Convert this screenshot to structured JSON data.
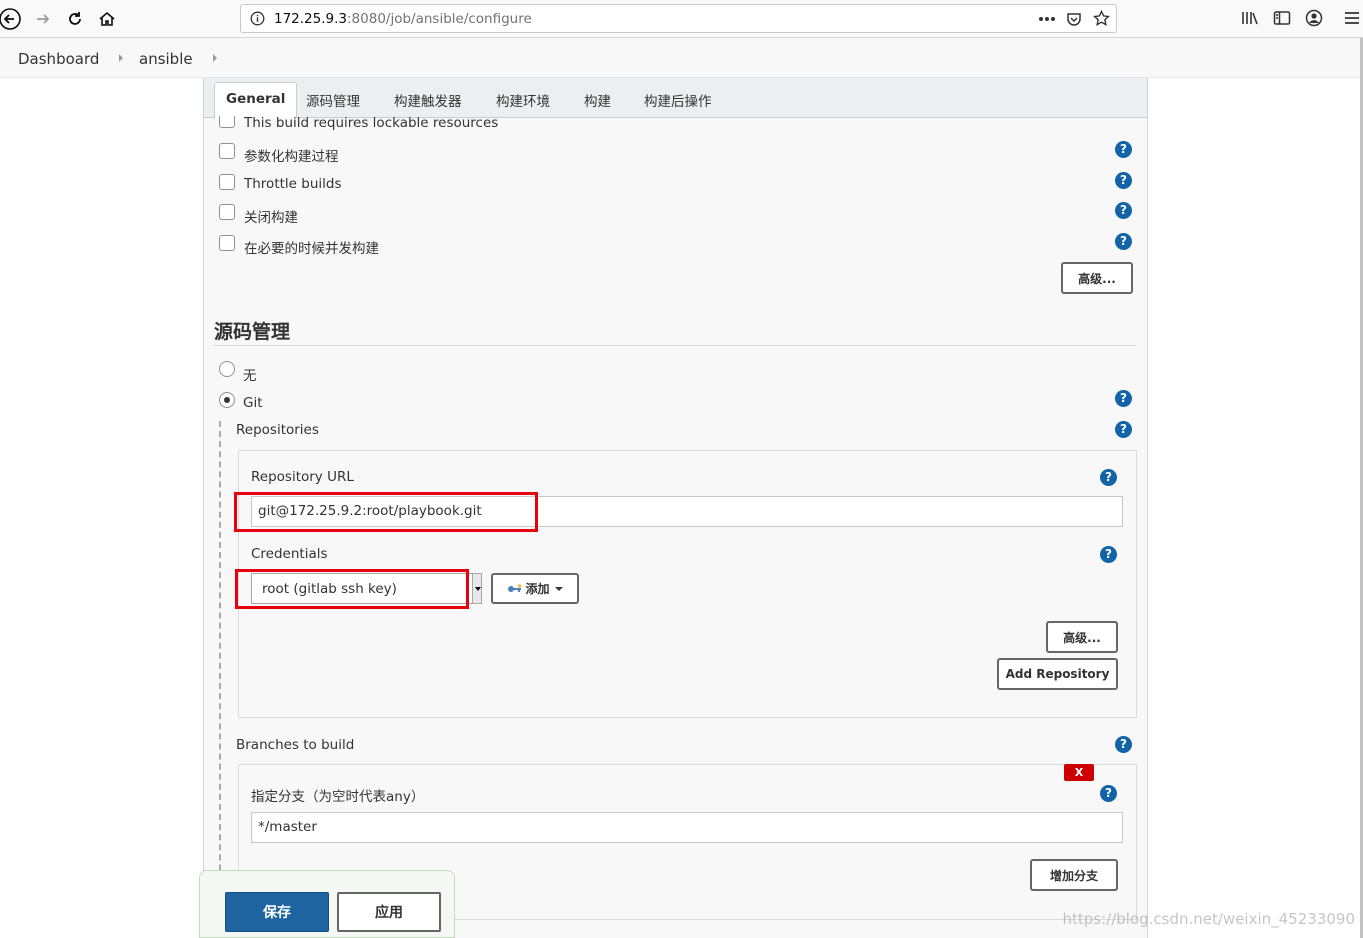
{
  "browser": {
    "url_host": "172.25.9.3",
    "url_path": ":8080/job/ansible/configure"
  },
  "breadcrumb": [
    "Dashboard",
    "ansible"
  ],
  "tabs": [
    "General",
    "源码管理",
    "构建触发器",
    "构建环境",
    "构建",
    "构建后操作"
  ],
  "general": {
    "options": [
      "This build requires lockable resources",
      "参数化构建过程",
      "Throttle builds",
      "关闭构建",
      "在必要的时候并发构建"
    ],
    "advanced_label": "高级..."
  },
  "scm": {
    "title": "源码管理",
    "option_none": "无",
    "option_git": "Git",
    "repositories_label": "Repositories",
    "repo_url_label": "Repository URL",
    "repo_url_value": "git@172.25.9.2:root/playbook.git",
    "credentials_label": "Credentials",
    "credentials_value": "root (gitlab ssh key)",
    "add_label": "添加",
    "advanced_label": "高级...",
    "add_repository_label": "Add Repository",
    "branches_label": "Branches to build",
    "branch_spec_label": "指定分支（为空时代表any）",
    "branch_spec_value": "*/master",
    "add_branch_label": "增加分支",
    "delete_label": "X"
  },
  "footer": {
    "save_label": "保存",
    "apply_label": "应用"
  },
  "help_glyph": "?",
  "watermark": "https://blog.csdn.net/weixin_45233090",
  "colors": {
    "help": "#1264a8",
    "primary": "#1e64a0",
    "highlight": "#e8000c",
    "delete": "#cc0000"
  }
}
